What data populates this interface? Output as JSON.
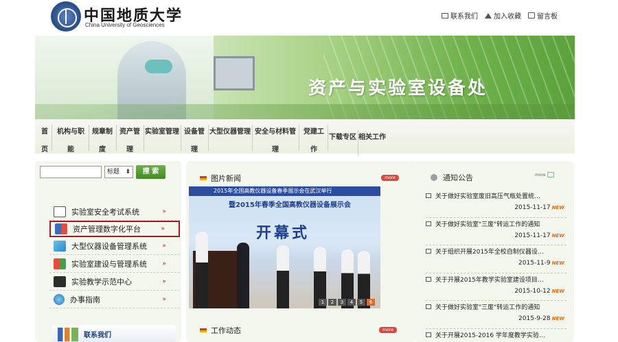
{
  "header": {
    "name_cn": "中国地质大学",
    "name_en": "China University of Geosciences",
    "links": [
      "联系我们",
      "加入收藏",
      "留言板"
    ]
  },
  "banner": {
    "title": "资产与实验室设备处"
  },
  "nav": [
    {
      "label": "首页"
    },
    {
      "label": "机构与职能"
    },
    {
      "label": "规章制度"
    },
    {
      "label": "资产管理"
    },
    {
      "label": "实验室管理"
    },
    {
      "label": "设备管理"
    },
    {
      "label": "大型仪器管理"
    },
    {
      "label": "安全与材料管理"
    },
    {
      "label": "党建工作"
    },
    {
      "label": "下载专区"
    },
    {
      "label": "相关工作"
    }
  ],
  "search": {
    "value": "",
    "select": "标题",
    "button": "搜 索"
  },
  "systems": [
    "实验室安全考试系统",
    "资产管理数字化平台",
    "大型仪器设备管理系统",
    "实验室建设与管理系统",
    "实验教学示范中心",
    "办事指南"
  ],
  "contact": "联系我们",
  "photo_news": {
    "title": "图片新闻",
    "more": "more",
    "banner_text": "2015年全国高教仪器设备春季展示会在武汉举行",
    "sub_text": "暨2015年春季全国高教仪器设备展示会",
    "big_text": "开幕式",
    "pager": [
      "1",
      "2",
      "3",
      "4",
      "5",
      "6"
    ]
  },
  "work_news": {
    "title": "工作动态",
    "more": "more"
  },
  "notice": {
    "title": "通知公告",
    "more": "more",
    "new_label": "NEW",
    "items": [
      {
        "title": "关于做好实验室废旧高压气瓶处置统…",
        "date": "2015-11-17"
      },
      {
        "title": "关于做好实验室\"三废\"转运工作的通知",
        "date": "2015-11-17"
      },
      {
        "title": "关于组织开展2015年全校自制仪器设…",
        "date": "2015-11-9"
      },
      {
        "title": "关于开展2015年教学实验室建设项目…",
        "date": "2015-10-12"
      },
      {
        "title": "关于做好实验室\"三废\"转运工作的通知",
        "date": "2015-9-28"
      },
      {
        "title": "关于开展2015-2016 学年度教学实验…",
        "date": ""
      }
    ]
  },
  "colors": {
    "accent_green": "#5ba23c",
    "highlight_red": "#a51c1c",
    "new_orange": "#e86b10"
  }
}
